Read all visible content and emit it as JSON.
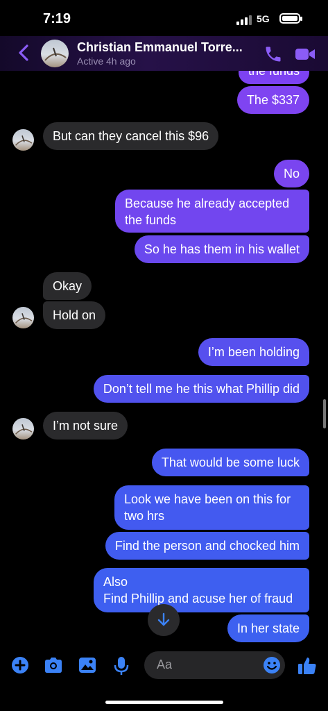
{
  "status_bar": {
    "time": "7:19",
    "network": "5G"
  },
  "header": {
    "contact_name": "Christian Emmanuel Torre...",
    "contact_status": "Active 4h ago",
    "icons": [
      "chevron-left-icon",
      "phone-icon",
      "video-camera-icon"
    ]
  },
  "messages": [
    {
      "side": "out",
      "text": "the funds"
    },
    {
      "side": "out",
      "text": "The $337"
    },
    {
      "side": "in",
      "text": "But can they cancel this $96"
    },
    {
      "side": "out",
      "text": "No"
    },
    {
      "side": "out",
      "text": "Because he already accepted the funds"
    },
    {
      "side": "out",
      "text": "So he has them in his wallet"
    },
    {
      "side": "in",
      "text": "Okay"
    },
    {
      "side": "in",
      "text": "Hold on"
    },
    {
      "side": "out",
      "text": "I’m been holding"
    },
    {
      "side": "out",
      "text": "Don’t tell me he this what Phillip did"
    },
    {
      "side": "in",
      "text": "I’m not sure"
    },
    {
      "side": "out",
      "text": "That would be some luck"
    },
    {
      "side": "out",
      "text": "Look we have been on this for two hrs"
    },
    {
      "side": "out",
      "text": "Find the person and chocked him"
    },
    {
      "side": "out",
      "text": "Also\nFind Phillip and acuse her of fraud"
    },
    {
      "side": "out",
      "text": "In her state"
    }
  ],
  "composer": {
    "placeholder": "Aa",
    "icons": [
      "plus-icon",
      "camera-icon",
      "image-icon",
      "microphone-icon",
      "emoji-icon",
      "thumbs-up-icon"
    ]
  },
  "colors": {
    "outgoing_purple": "#7c44f0",
    "outgoing_blue": "#3f5ff0",
    "incoming": "#2a2a2c",
    "accent": "#8b5cf6",
    "composer_blue": "#3b82f6"
  }
}
